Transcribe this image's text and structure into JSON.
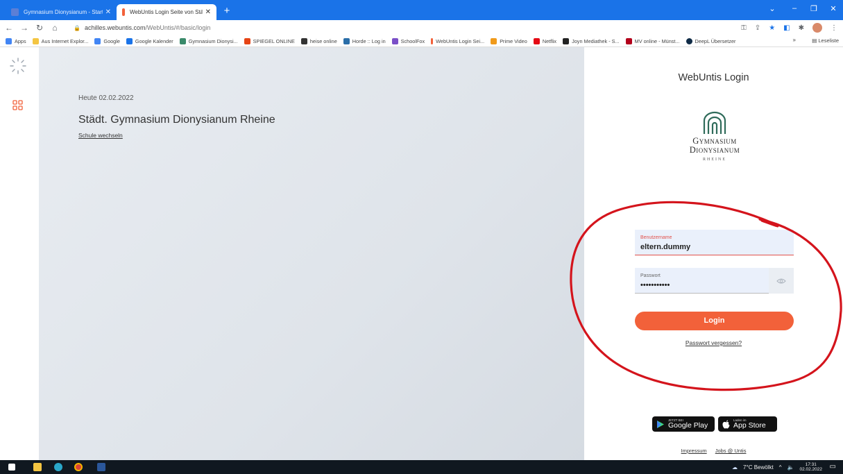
{
  "browser": {
    "tabs": [
      {
        "title": "Gymnasium Dionysianum - Startseite",
        "favicon_color": "#5b7fd6"
      },
      {
        "title": "WebUntis Login Seite von Städt. Gymnasium",
        "favicon_color": "#f2613a"
      }
    ],
    "new_tab_symbol": "+",
    "url_host": "achilles.webuntis.com",
    "url_path": "/WebUntis/#/basic/login",
    "bookmarks": [
      {
        "label": "Apps",
        "icon_color": "#4285f4"
      },
      {
        "label": "Aus Internet Explor...",
        "icon_color": "#f4c542"
      },
      {
        "label": "Google",
        "icon_color": "#4285f4"
      },
      {
        "label": "Google Kalender",
        "icon_color": "#1a73e8"
      },
      {
        "label": "Gymnasium Dionysi...",
        "icon_color": "#3a8a6a"
      },
      {
        "label": "SPIEGEL ONLINE",
        "icon_color": "#e64415"
      },
      {
        "label": "heise online",
        "icon_color": "#333333"
      },
      {
        "label": "Horde :: Log in",
        "icon_color": "#2a6ea8"
      },
      {
        "label": "SchoolFox",
        "icon_color": "#7a4fc7"
      },
      {
        "label": "WebUntis Login Sei...",
        "icon_color": "#f2613a"
      },
      {
        "label": "Prime Video",
        "icon_color": "#f09a1a"
      },
      {
        "label": "Netflix",
        "icon_color": "#e50914"
      },
      {
        "label": "Joyn Mediathek - S...",
        "icon_color": "#222222"
      },
      {
        "label": "MV online - Münst...",
        "icon_color": "#b3001b"
      },
      {
        "label": "DeepL Übersetzer",
        "icon_color": "#0f2b46"
      }
    ],
    "bookmarks_more": "»",
    "reading_list": "Leseliste"
  },
  "hero": {
    "date": "Heute 02.02.2022",
    "school_name": "Städt. Gymnasium Dionysianum Rheine",
    "switch_school": "Schule wechseln"
  },
  "login": {
    "title": "WebUntis Login",
    "logo": {
      "line1": "Gymnasium",
      "line2": "Dionysianum",
      "line3": "RHEINE",
      "color": "#2f6b5a"
    },
    "username_label": "Benutzername",
    "username_value": "eltern.dummy",
    "password_label": "Passwort",
    "password_value": "•••••••••••",
    "login_button": "Login",
    "forgot_link": "Passwort vergessen?",
    "google_play": {
      "small": "JETZT BEI",
      "big": "Google Play"
    },
    "app_store": {
      "small": "Laden im",
      "big": "App Store"
    },
    "footer": {
      "imprint": "Impressum",
      "jobs": "Jobs @ Untis"
    },
    "accent_color": "#f2613a"
  },
  "taskbar": {
    "weather": "7°C  Bewölkt",
    "time": "17:31",
    "date": "02.02.2022"
  }
}
